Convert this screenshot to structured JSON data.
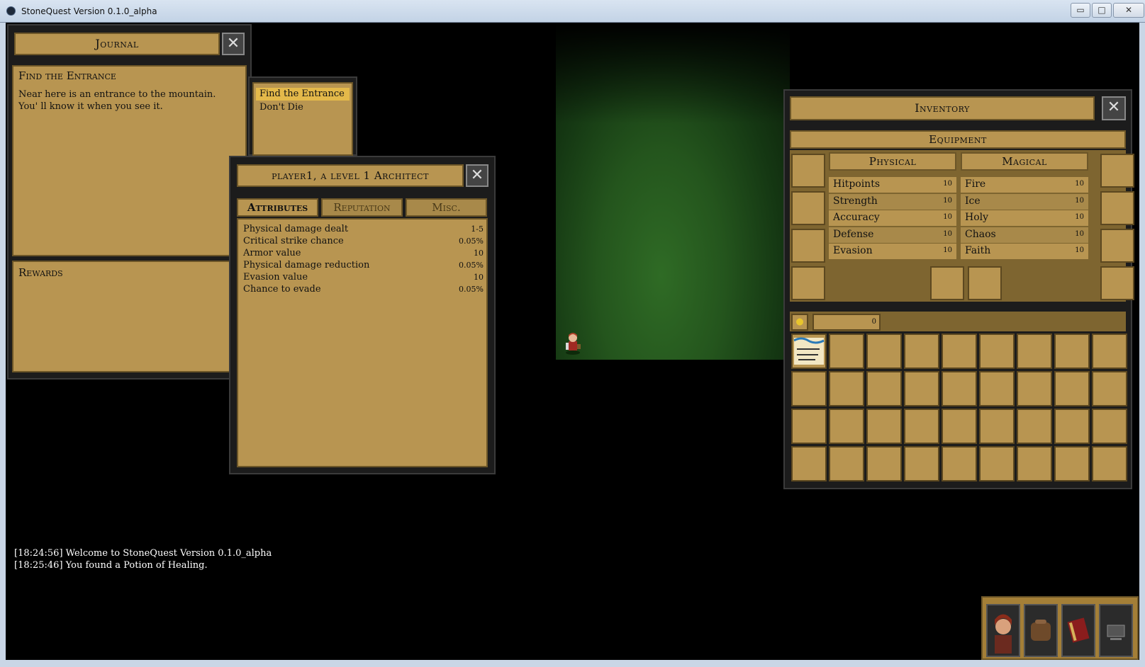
{
  "window": {
    "title": "StoneQuest Version 0.1.0_alpha",
    "min_label": "▭",
    "max_label": "□",
    "close_label": "✕"
  },
  "journal": {
    "title": "Journal",
    "quest_title": "Find the Entrance",
    "quest_text": "Near here is an entrance to the mountain. You' ll know it when you see it.",
    "rewards_title": "Rewards",
    "quests": [
      "Find the Entrance",
      "Don't Die"
    ]
  },
  "character": {
    "title": "player1, a level 1 Architect",
    "tabs": [
      "Attributes",
      "Reputation",
      "Misc."
    ],
    "attributes": [
      {
        "label": "Physical damage dealt",
        "value": "1-5"
      },
      {
        "label": "Critical strike chance",
        "value": "0.05%"
      },
      {
        "label": "Armor value",
        "value": "10"
      },
      {
        "label": "Physical damage reduction",
        "value": "0.05%"
      },
      {
        "label": "Evasion value",
        "value": "10"
      },
      {
        "label": "Chance to evade",
        "value": "0.05%"
      }
    ]
  },
  "inventory": {
    "title": "Inventory",
    "equipment_label": "Equipment",
    "physical_label": "Physical",
    "magical_label": "Magical",
    "physical": [
      {
        "label": "Hitpoints",
        "value": "10"
      },
      {
        "label": "Strength",
        "value": "10"
      },
      {
        "label": "Accuracy",
        "value": "10"
      },
      {
        "label": "Defense",
        "value": "10"
      },
      {
        "label": "Evasion",
        "value": "10"
      }
    ],
    "magical": [
      {
        "label": "Fire",
        "value": "10"
      },
      {
        "label": "Ice",
        "value": "10"
      },
      {
        "label": "Holy",
        "value": "10"
      },
      {
        "label": "Chaos",
        "value": "10"
      },
      {
        "label": "Faith",
        "value": "10"
      }
    ],
    "gold": "0"
  },
  "chat": [
    "[18:24:56] Welcome to StoneQuest Version 0.1.0_alpha",
    "[18:25:46] You found a Potion of Healing."
  ],
  "colors": {
    "parchment": "#b89551",
    "panel": "#1c1c1c",
    "grass": "#2f6b25"
  }
}
